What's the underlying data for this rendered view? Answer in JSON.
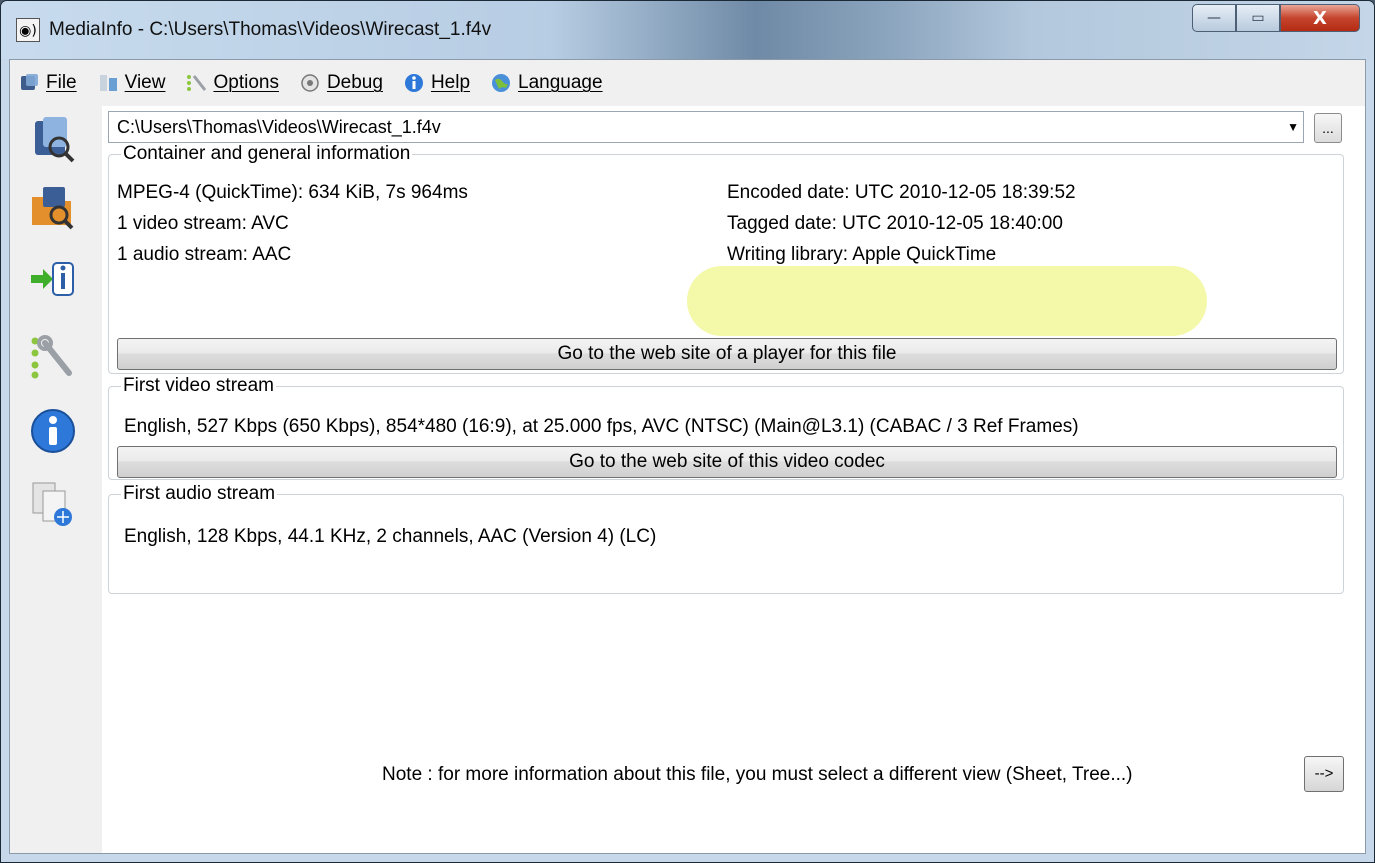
{
  "window": {
    "title": "MediaInfo - C:\\Users\\Thomas\\Videos\\Wirecast_1.f4v",
    "app_icon_glyph": "◉)",
    "controls": {
      "minimize": "—",
      "maximize": "▭",
      "close": "X"
    }
  },
  "menu": [
    {
      "label": "File",
      "icon": "file-menu-icon"
    },
    {
      "label": "View",
      "icon": "view-menu-icon"
    },
    {
      "label": "Options",
      "icon": "options-menu-icon"
    },
    {
      "label": "Debug",
      "icon": "debug-menu-icon"
    },
    {
      "label": "Help",
      "icon": "help-menu-icon"
    },
    {
      "label": "Language",
      "icon": "language-menu-icon"
    }
  ],
  "sidebar": [
    "open-file-icon",
    "open-folder-icon",
    "export-icon",
    "preferences-icon",
    "about-icon",
    "web-icon"
  ],
  "file_path": {
    "value": "C:\\Users\\Thomas\\Videos\\Wirecast_1.f4v",
    "browse_label": "..."
  },
  "general": {
    "legend": "Container and general information",
    "left_lines": [
      "MPEG-4 (QuickTime): 634 KiB, 7s 964ms",
      "1 video stream: AVC",
      "1 audio stream: AAC"
    ],
    "right_lines": [
      "Encoded date: UTC 2010-12-05 18:39:52",
      "Tagged date: UTC 2010-12-05 18:40:00",
      "Writing library: Apple QuickTime"
    ],
    "button": "Go to the web site of a player for this file"
  },
  "video": {
    "legend": "First video stream",
    "line": "English, 527 Kbps (650 Kbps), 854*480 (16:9), at 25.000 fps, AVC (NTSC) (Main@L3.1) (CABAC / 3 Ref Frames)",
    "button": "Go to the web site of this video codec"
  },
  "audio": {
    "legend": "First audio stream",
    "line": "English, 128 Kbps, 44.1 KHz, 2 channels, AAC (Version 4) (LC)"
  },
  "note": {
    "text": "Note : for more information about this file, you must select a different view (Sheet, Tree...)",
    "button": "-->"
  }
}
